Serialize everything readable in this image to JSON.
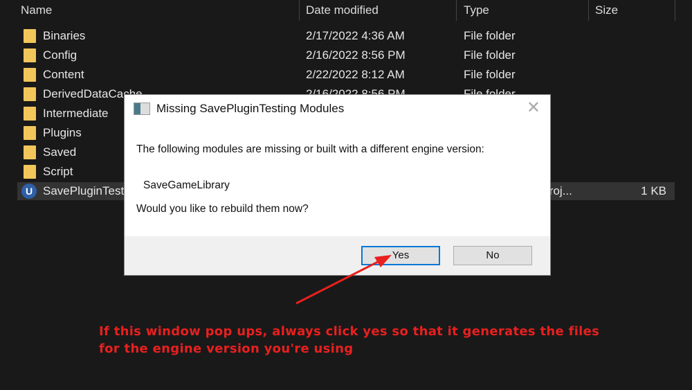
{
  "columns": {
    "name": "Name",
    "date": "Date modified",
    "type": "Type",
    "size": "Size"
  },
  "files": [
    {
      "name": "Binaries",
      "date": "2/17/2022 4:36 AM",
      "type": "File folder",
      "size": "",
      "icon": "folder-icon"
    },
    {
      "name": "Config",
      "date": "2/16/2022 8:56 PM",
      "type": "File folder",
      "size": "",
      "icon": "folder-icon"
    },
    {
      "name": "Content",
      "date": "2/22/2022 8:12 AM",
      "type": "File folder",
      "size": "",
      "icon": "folder-icon"
    },
    {
      "name": "DerivedDataCache",
      "date": "2/16/2022 8:56 PM",
      "type": "File folder",
      "size": "",
      "icon": "folder-icon"
    },
    {
      "name": "Intermediate",
      "date": "",
      "type": "",
      "size": "",
      "icon": "folder-icon"
    },
    {
      "name": "Plugins",
      "date": "",
      "type": "",
      "size": "",
      "icon": "folder-icon"
    },
    {
      "name": "Saved",
      "date": "",
      "type": "",
      "size": "",
      "icon": "folder-icon"
    },
    {
      "name": "Script",
      "date": "",
      "type": "",
      "size": "",
      "icon": "folder-icon"
    },
    {
      "name": "SavePluginTesting",
      "date": "",
      "type": "Unreal Engine Proj...",
      "size": "1 KB",
      "icon": "unreal-engine-icon"
    }
  ],
  "dialog": {
    "title": "Missing SavePluginTesting Modules",
    "message": "The following modules are missing or built with a different engine version:",
    "module": "SaveGameLibrary",
    "question": "Would you like to rebuild them now?",
    "yes": "Yes",
    "no": "No"
  },
  "annotation": {
    "line1": "If this window pop ups, always click yes so that it generates the files",
    "line2": "for the engine version you're using",
    "color": "#e8201f"
  }
}
